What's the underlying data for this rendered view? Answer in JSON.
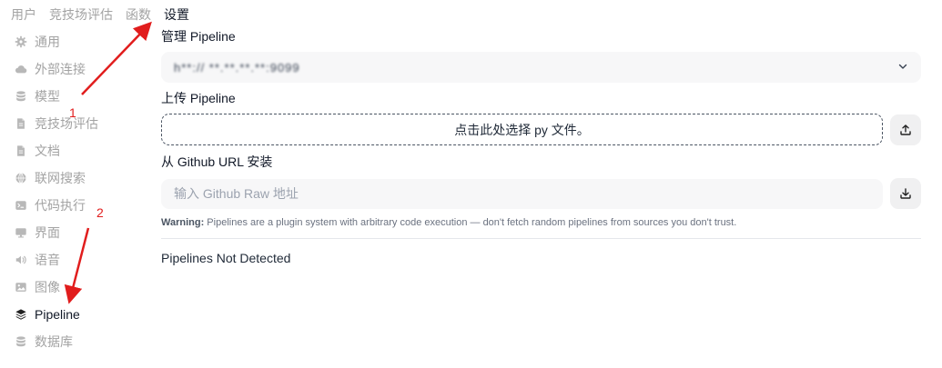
{
  "top_tabs": [
    {
      "label": "用户",
      "active": false
    },
    {
      "label": "竞技场评估",
      "active": false
    },
    {
      "label": "函数",
      "active": false
    },
    {
      "label": "设置",
      "active": true
    }
  ],
  "sidebar": {
    "items": [
      {
        "label": "通用",
        "icon": "gear-icon",
        "active": false
      },
      {
        "label": "外部连接",
        "icon": "cloud-icon",
        "active": false
      },
      {
        "label": "模型",
        "icon": "database-icon",
        "active": false
      },
      {
        "label": "竞技场评估",
        "icon": "document-icon",
        "active": false
      },
      {
        "label": "文档",
        "icon": "document-icon",
        "active": false
      },
      {
        "label": "联网搜索",
        "icon": "globe-icon",
        "active": false
      },
      {
        "label": "代码执行",
        "icon": "terminal-icon",
        "active": false
      },
      {
        "label": "界面",
        "icon": "monitor-icon",
        "active": false
      },
      {
        "label": "语音",
        "icon": "speaker-icon",
        "active": false
      },
      {
        "label": "图像",
        "icon": "image-icon",
        "active": false
      },
      {
        "label": "Pipeline",
        "icon": "layers-icon",
        "active": true
      },
      {
        "label": "数据库",
        "icon": "database-icon",
        "active": false
      }
    ]
  },
  "main": {
    "manage_label": "管理 Pipeline",
    "pipeline_select_value": "h**:// **.**.**.**:9099",
    "upload_label": "上传 Pipeline",
    "upload_box_text": "点击此处选择 py 文件。",
    "github_label": "从 Github URL 安装",
    "github_placeholder": "输入 Github Raw 地址",
    "warning_title": "Warning:",
    "warning_text": " Pipelines are a plugin system with arbitrary code execution — don't fetch random pipelines from sources you don't trust.",
    "status_text": "Pipelines Not Detected"
  },
  "annotations": {
    "marker_1": "1",
    "marker_2": "2",
    "arrow_color": "#e11d1d"
  }
}
